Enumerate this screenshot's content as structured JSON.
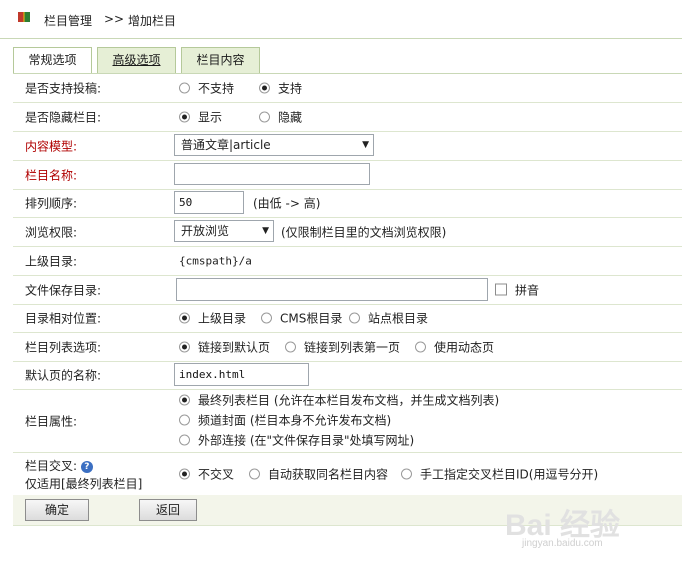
{
  "breadcrumb": {
    "section": "栏目管理",
    "separator": ">>",
    "page": "增加栏目"
  },
  "tabs": [
    {
      "label": "常规选项"
    },
    {
      "label": "高级选项"
    },
    {
      "label": "栏目内容"
    }
  ],
  "rows": {
    "submission": {
      "label": "是否支持投稿:",
      "opt1": "不支持",
      "opt2": "支持"
    },
    "hidden": {
      "label": "是否隐藏栏目:",
      "opt1": "显示",
      "opt2": "隐藏"
    },
    "model": {
      "label": "内容模型:",
      "value": "普通文章|article"
    },
    "name": {
      "label": "栏目名称:",
      "value": ""
    },
    "order": {
      "label": "排列顺序:",
      "value": "50",
      "hint": "(由低 -> 高)"
    },
    "access": {
      "label": "浏览权限:",
      "value": "开放浏览",
      "hint": "(仅限制栏目里的文档浏览权限)"
    },
    "parent": {
      "label": "上级目录:",
      "value": "{cmspath}/a"
    },
    "savedir": {
      "label": "文件保存目录:",
      "value": "",
      "pinyin": "拼音"
    },
    "relative": {
      "label": "目录相对位置:",
      "opt1": "上级目录",
      "opt2": "CMS根目录",
      "opt3": "站点根目录"
    },
    "listopt": {
      "label": "栏目列表选项:",
      "opt1": "链接到默认页",
      "opt2": "链接到列表第一页",
      "opt3": "使用动态页"
    },
    "defaultpage": {
      "label": "默认页的名称:",
      "value": "index.html"
    },
    "attr": {
      "label": "栏目属性:",
      "opt1": "最终列表栏目 (允许在本栏目发布文档，并生成文档列表)",
      "opt2": "频道封面 (栏目本身不允许发布文档)",
      "opt3": "外部连接 (在\"文件保存目录\"处填写网址)"
    },
    "cross": {
      "label1": "栏目交叉:",
      "help": "?",
      "label2": "仅适用[最终列表栏目]",
      "opt1": "不交叉",
      "opt2": "自动获取同名栏目内容",
      "opt3": "手工指定交叉栏目ID(用逗号分开)"
    }
  },
  "buttons": {
    "ok": "确定",
    "back": "返回"
  },
  "watermark": {
    "text": "Bai 经验",
    "sub": "jingyan.baidu.com"
  }
}
